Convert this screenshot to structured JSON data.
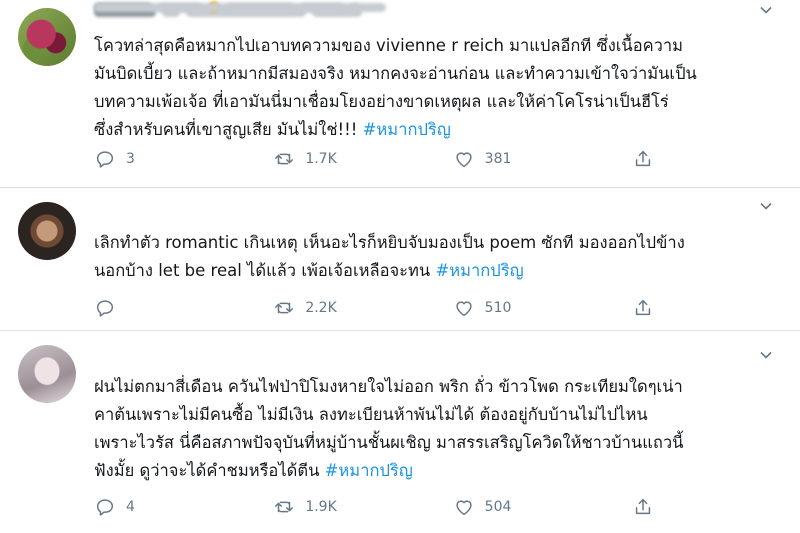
{
  "tweets": [
    {
      "body_lines": [
        "โควทล่าสุดคือหมากไปเอาบทความของ vivienne r reich มาแปลอีกที ซึ่งเนื้อความ",
        "มันบิดเบี้ยว และถ้าหมากมีสมองจริง หมากคงจะอ่านก่อน และทำความเข้าใจว่ามันเป็น",
        "บทความเพ้อเจ้อ ที่เอามันนี่มาเชื่อมโยงอย่างขาดเหตุผล และให้ค่าโคโรน่าเป็นฮีโร่",
        "ซึ่งสำหรับคนที่เขาสูญเสีย มันไม่ใช่!!! "
      ],
      "hashtag": "#หมากปริญ",
      "replies": "3",
      "retweets": "1.7K",
      "likes": "381"
    },
    {
      "body_lines": [
        "เลิกทำตัว romantic เกินเหตุ เห็นอะไรก็หยิบจับมองเป็น poem ซักที มองออกไปข้าง",
        "นอกบ้าง let be real ได้แล้ว เพ้อเจ้อเหลือจะทน "
      ],
      "hashtag": "#หมากปริญ",
      "replies": "",
      "retweets": "2.2K",
      "likes": "510"
    },
    {
      "body_lines": [
        "ฝนไม่ตกมาสี่เดือน ควันไฟป่าปิโมงหายใจไม่ออก พริก ถั่ว ข้าวโพด กระเทียมใดๆเน่า",
        "คาต้นเพราะไม่มีคนซื้อ ไม่มีเงิน ลงทะเบียนห้าพันไม่ได้ ต้องอยู่กับบ้านไม่ไปไหน",
        "เพราะไวรัส นี่คือสภาพปัจจุบันที่หมู่บ้านชั้นผเชิญ มาสรรเสริญโควิดให้ชาวบ้านแถวนี้",
        "ฟังมั้ย ดูว่าจะได้คำชมหรือได้ตีน "
      ],
      "hashtag": "#หมากปริญ",
      "replies": "4",
      "retweets": "1.9K",
      "likes": "504"
    }
  ],
  "icons": {
    "reply": "reply-icon",
    "retweet": "retweet-icon",
    "like": "heart-icon",
    "share": "share-icon",
    "menu": "chevron-down-icon"
  },
  "colors": {
    "hashtag": "#1b95e0",
    "icon": "#657786",
    "divider": "#d9dfe4"
  }
}
